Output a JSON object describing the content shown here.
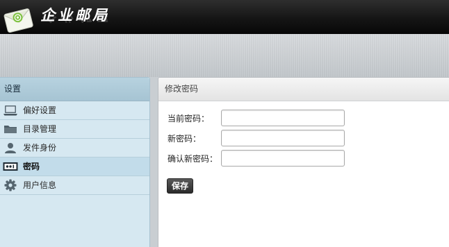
{
  "header": {
    "title": "企业邮局",
    "logo_icon": "envelope-logo-icon"
  },
  "sidebar": {
    "title": "设置",
    "items": [
      {
        "label": "偏好设置",
        "icon": "laptop-icon",
        "active": false
      },
      {
        "label": "目录管理",
        "icon": "folder-icon",
        "active": false
      },
      {
        "label": "发件身份",
        "icon": "user-icon",
        "active": false
      },
      {
        "label": "密码",
        "icon": "password-field-icon",
        "active": true
      },
      {
        "label": "用户信息",
        "icon": "gear-icon",
        "active": false
      }
    ]
  },
  "panel": {
    "title": "修改密码",
    "fields": [
      {
        "label": "当前密码：",
        "value": ""
      },
      {
        "label": "新密码：",
        "value": ""
      },
      {
        "label": "确认新密码：",
        "value": ""
      }
    ],
    "save_label": "保存"
  },
  "colors": {
    "header_bg": "#111111",
    "sidebar_bg": "#d6e8f1",
    "sidebar_header_bg": "#a9c6d5",
    "active_item_bg": "#c2dcea",
    "button_bg": "#333333"
  }
}
